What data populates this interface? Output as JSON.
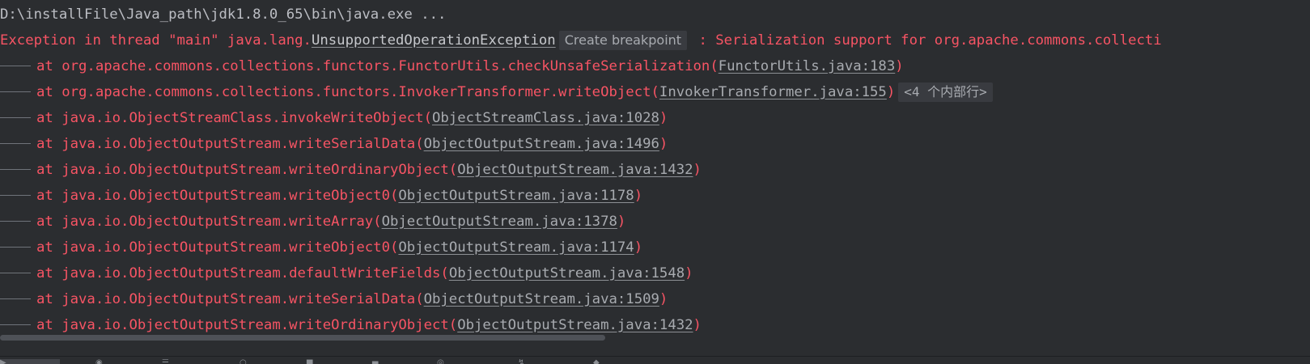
{
  "console": {
    "command_line": "D:\\installFile\\Java_path\\jdk1.8.0_65\\bin\\java.exe ...",
    "exception": {
      "prefix": "Exception in thread \"main\" java.lang.",
      "class_link": "UnsupportedOperationException",
      "breakpoint_chip": "Create breakpoint",
      "message": " : Serialization support for org.apache.commons.collecti"
    },
    "frames": [
      {
        "method": "at org.apache.commons.collections.functors.FunctorUtils.checkUnsafeSerialization(",
        "source": "FunctorUtils.java:183",
        "suffix": ")"
      },
      {
        "method": "at org.apache.commons.collections.functors.InvokerTransformer.writeObject(",
        "source": "InvokerTransformer.java:155",
        "suffix": ")",
        "folded_label": "<4 个内部行>"
      },
      {
        "method": "at java.io.ObjectStreamClass.invokeWriteObject(",
        "source": "ObjectStreamClass.java:1028",
        "suffix": ")"
      },
      {
        "method": "at java.io.ObjectOutputStream.writeSerialData(",
        "source": "ObjectOutputStream.java:1496",
        "suffix": ")"
      },
      {
        "method": "at java.io.ObjectOutputStream.writeOrdinaryObject(",
        "source": "ObjectOutputStream.java:1432",
        "suffix": ")"
      },
      {
        "method": "at java.io.ObjectOutputStream.writeObject0(",
        "source": "ObjectOutputStream.java:1178",
        "suffix": ")"
      },
      {
        "method": "at java.io.ObjectOutputStream.writeArray(",
        "source": "ObjectOutputStream.java:1378",
        "suffix": ")"
      },
      {
        "method": "at java.io.ObjectOutputStream.writeObject0(",
        "source": "ObjectOutputStream.java:1174",
        "suffix": ")"
      },
      {
        "method": "at java.io.ObjectOutputStream.defaultWriteFields(",
        "source": "ObjectOutputStream.java:1548",
        "suffix": ")"
      },
      {
        "method": "at java.io.ObjectOutputStream.writeSerialData(",
        "source": "ObjectOutputStream.java:1509",
        "suffix": ")"
      },
      {
        "method": "at java.io.ObjectOutputStream.writeOrdinaryObject(",
        "source": "ObjectOutputStream.java:1432",
        "suffix": ")"
      }
    ]
  },
  "colors": {
    "background": "#2b2d30",
    "error_text": "#f75464",
    "command_text": "#bcbec4",
    "link_text": "#a8abb0",
    "chip_background": "#393b40"
  },
  "toolbar_icons": [
    "run-icon",
    "debug-icon",
    "list-icon",
    "search-icon",
    "terminal-icon",
    "build-icon",
    "problems-icon",
    "git-icon",
    "services-icon"
  ]
}
